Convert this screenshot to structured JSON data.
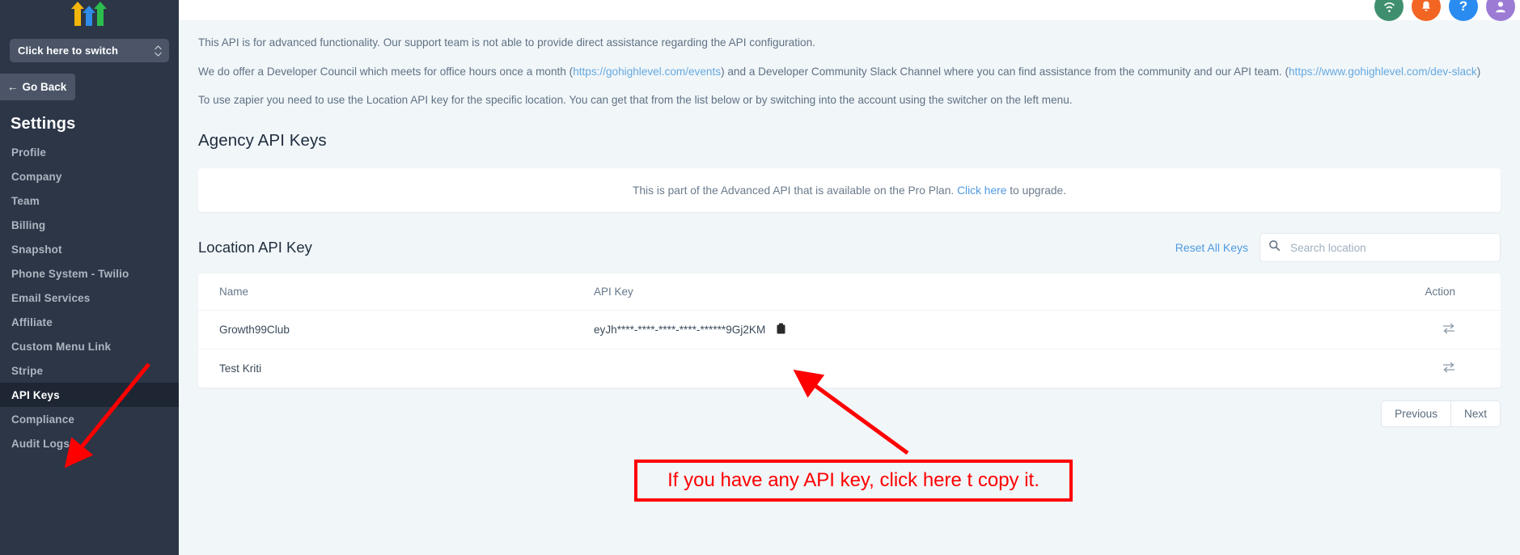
{
  "sidebar": {
    "logo_name": "triple-arrow-logo",
    "switcher": {
      "label": "Click here to switch"
    },
    "go_back": {
      "label": "Go Back"
    },
    "heading": "Settings",
    "items": [
      {
        "label": "Profile",
        "active": false
      },
      {
        "label": "Company",
        "active": false
      },
      {
        "label": "Team",
        "active": false
      },
      {
        "label": "Billing",
        "active": false
      },
      {
        "label": "Snapshot",
        "active": false
      },
      {
        "label": "Phone System - Twilio",
        "active": false
      },
      {
        "label": "Email Services",
        "active": false
      },
      {
        "label": "Affiliate",
        "active": false
      },
      {
        "label": "Custom Menu Link",
        "active": false
      },
      {
        "label": "Stripe",
        "active": false
      },
      {
        "label": "API Keys",
        "active": true
      },
      {
        "label": "Compliance",
        "active": false
      },
      {
        "label": "Audit Logs",
        "active": false
      }
    ]
  },
  "topbar": {
    "icons": [
      {
        "name": "wifi-status-icon",
        "glyph": "◔",
        "color": "#3f8f6f"
      },
      {
        "name": "notifications-bell-icon",
        "glyph": "🔔",
        "color": "#f26522"
      },
      {
        "name": "help-question-icon",
        "glyph": "?",
        "color": "#2a8cf0"
      },
      {
        "name": "user-avatar-icon",
        "glyph": "",
        "color": "#9b7bd4"
      }
    ]
  },
  "intro": {
    "p1": "This API is for advanced functionality. Our support team is not able to provide direct assistance regarding the API configuration.",
    "p2_a": "We do offer a Developer Council which meets for office hours once a month (",
    "p2_link1": "https://gohighlevel.com/events",
    "p2_b": ") and a Developer Community Slack Channel where you can find assistance from the community and our API team. (",
    "p2_link2": "https://www.gohighlevel.com/dev-slack",
    "p2_c": ")",
    "p3": "To use zapier you need to use the Location API key for the specific location. You can get that from the list below or by switching into the account using the switcher on the left menu."
  },
  "agency_section": {
    "title": "Agency API Keys",
    "pro_notice_a": "This is part of the Advanced API that is available on the Pro Plan. ",
    "pro_notice_link": "Click here",
    "pro_notice_b": " to upgrade."
  },
  "location_section": {
    "title": "Location API Key",
    "reset_all_keys": "Reset All Keys",
    "search": {
      "placeholder": "Search location",
      "value": ""
    },
    "table": {
      "columns": [
        "Name",
        "API Key",
        "Action"
      ],
      "rows": [
        {
          "name": "Growth99Club",
          "api_key": "eyJh****-****-****-****-******9Gj2KM",
          "has_copy": true,
          "action_icon": "swap-icon"
        },
        {
          "name": "Test Kriti",
          "api_key": "",
          "has_copy": false,
          "action_icon": "swap-icon"
        }
      ]
    },
    "pagination": {
      "previous": "Previous",
      "next": "Next"
    }
  },
  "annotation": {
    "text": "If you have any API key, click here t copy it.",
    "color": "#ff0000"
  }
}
